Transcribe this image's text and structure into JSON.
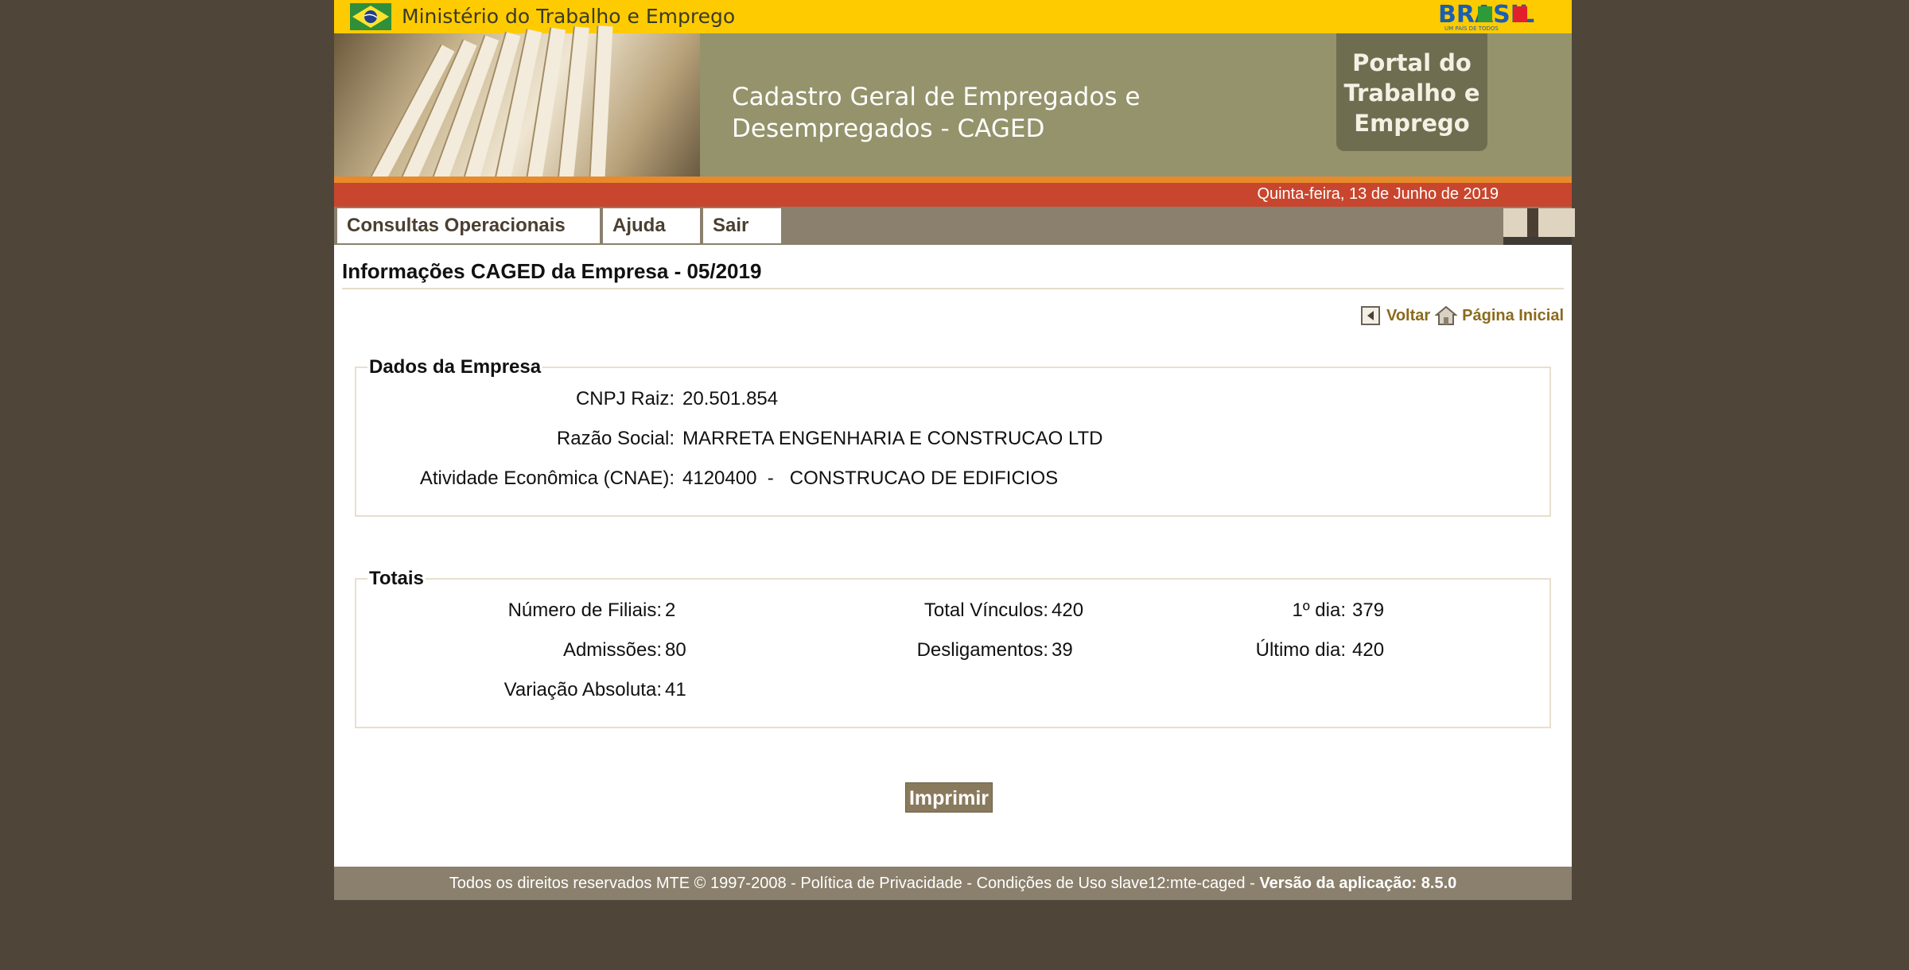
{
  "header": {
    "ministry": "Ministério do Trabalho e Emprego",
    "brasil_logo": "BRASIL",
    "brasil_tagline": "UM PAÍS DE TODOS",
    "system_title": "Cadastro Geral de Empregados e Desempregados - CAGED",
    "portal": "Portal do Trabalho e Emprego",
    "date": "Quinta-feira, 13 de Junho de 2019"
  },
  "menu": {
    "items": [
      "Consultas Operacionais",
      "Ajuda",
      "Sair"
    ]
  },
  "main": {
    "title": "Informações CAGED da Empresa - 05/2019",
    "nav": {
      "back": "Voltar",
      "home": "Página Inicial"
    },
    "empresa": {
      "legend": "Dados da Empresa",
      "cnpj_label": "CNPJ Raiz:",
      "cnpj_value": "20.501.854",
      "razao_label": "Razão Social:",
      "razao_value": "MARRETA ENGENHARIA E CONSTRUCAO LTD",
      "cnae_label": "Atividade Econômica (CNAE):",
      "cnae_value": "4120400  -   CONSTRUCAO DE EDIFICIOS"
    },
    "totais": {
      "legend": "Totais",
      "filiais_label": "Número de Filiais:",
      "filiais_value": "2",
      "vinculos_label": "Total Vínculos:",
      "vinculos_value": "420",
      "primeiro_label": "1º dia:",
      "primeiro_value": "379",
      "admissoes_label": "Admissões:",
      "admissoes_value": "80",
      "desligamentos_label": "Desligamentos:",
      "desligamentos_value": "39",
      "ultimo_label": "Último dia:",
      "ultimo_value": "420",
      "variacao_label": "Variação Absoluta:",
      "variacao_value": "41"
    },
    "print_button": "Imprimir"
  },
  "footer": {
    "text": "Todos os direitos reservados MTE © 1997-2008 - Política de Privacidade - Condições de Uso slave12:mte-caged - ",
    "version": "Versão da aplicação: 8.5.0"
  },
  "colors": {
    "background": "#4f4639",
    "yellow": "#fecb00",
    "banner": "#94936b",
    "date_bar": "#c8462d",
    "menu_bar": "#8b806d",
    "link": "#8b6a1c"
  }
}
